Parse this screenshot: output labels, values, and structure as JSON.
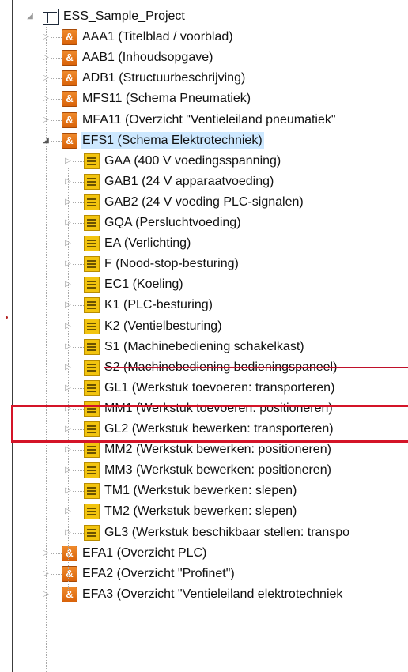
{
  "tree": {
    "root": {
      "label": "ESS_Sample_Project",
      "icon": "project-icon"
    },
    "top_items": [
      {
        "label": "AAA1 (Titelblad / voorblad)",
        "icon": "orange-page-icon",
        "glyph": "&"
      },
      {
        "label": "AAB1 (Inhoudsopgave)",
        "icon": "orange-page-icon",
        "glyph": "&"
      },
      {
        "label": "ADB1 (Structuurbeschrijving)",
        "icon": "orange-page-icon",
        "glyph": "&"
      },
      {
        "label": "MFS11 (Schema Pneumatiek)",
        "icon": "orange-page-icon",
        "glyph": "&"
      },
      {
        "label": "MFA11 (Overzicht \"Ventieleiland pneumatiek\"",
        "icon": "orange-page-icon",
        "glyph": "&"
      },
      {
        "label": "EFS1 (Schema Elektrotechniek)",
        "icon": "orange-page-icon",
        "glyph": "&",
        "selected": true
      }
    ],
    "children": [
      {
        "label": "GAA (400 V voedingsspanning)"
      },
      {
        "label": "GAB1 (24 V apparaatvoeding)"
      },
      {
        "label": "GAB2 (24 V voeding PLC-signalen)"
      },
      {
        "label": "GQA (Persluchtvoeding)"
      },
      {
        "label": "EA (Verlichting)"
      },
      {
        "label": "F (Nood-stop-besturing)"
      },
      {
        "label": "EC1 (Koeling)"
      },
      {
        "label": "K1 (PLC-besturing)"
      },
      {
        "label": "K2 (Ventielbesturing)"
      },
      {
        "label": "S1 (Machinebediening schakelkast)"
      },
      {
        "label": "S2 (Machinebediening bedieningspaneel)",
        "struck": true
      },
      {
        "label": "GL1 (Werkstuk toevoeren: transporteren)",
        "highlighted": true
      },
      {
        "label": "MM1 (Werkstuk toevoeren: positioneren)"
      },
      {
        "label": "GL2 (Werkstuk bewerken: transporteren)"
      },
      {
        "label": "MM2 (Werkstuk bewerken: positioneren)"
      },
      {
        "label": "MM3 (Werkstuk bewerken: positioneren)"
      },
      {
        "label": "TM1 (Werkstuk bewerken: slepen)"
      },
      {
        "label": "TM2 (Werkstuk bewerken: slepen)"
      },
      {
        "label": "GL3 (Werkstuk beschikbaar stellen: transpo"
      }
    ],
    "bottom_items": [
      {
        "label": "EFA1 (Overzicht PLC)",
        "icon": "orange-page-icon",
        "glyph": "&"
      },
      {
        "label": "EFA2 (Overzicht \"Profinet\")",
        "icon": "orange-page-icon",
        "glyph": "&"
      },
      {
        "label": "EFA3 (Overzicht \"Ventieleiland elektrotechniek",
        "icon": "orange-page-icon",
        "glyph": "&"
      }
    ],
    "expand_glyph": "▷",
    "collapse_glyph": "◢"
  },
  "colors": {
    "selection": "#cde8ff",
    "highlight_box": "#d41428",
    "orange_icon": "#e8751a",
    "yellow_icon": "#f2c40f"
  }
}
